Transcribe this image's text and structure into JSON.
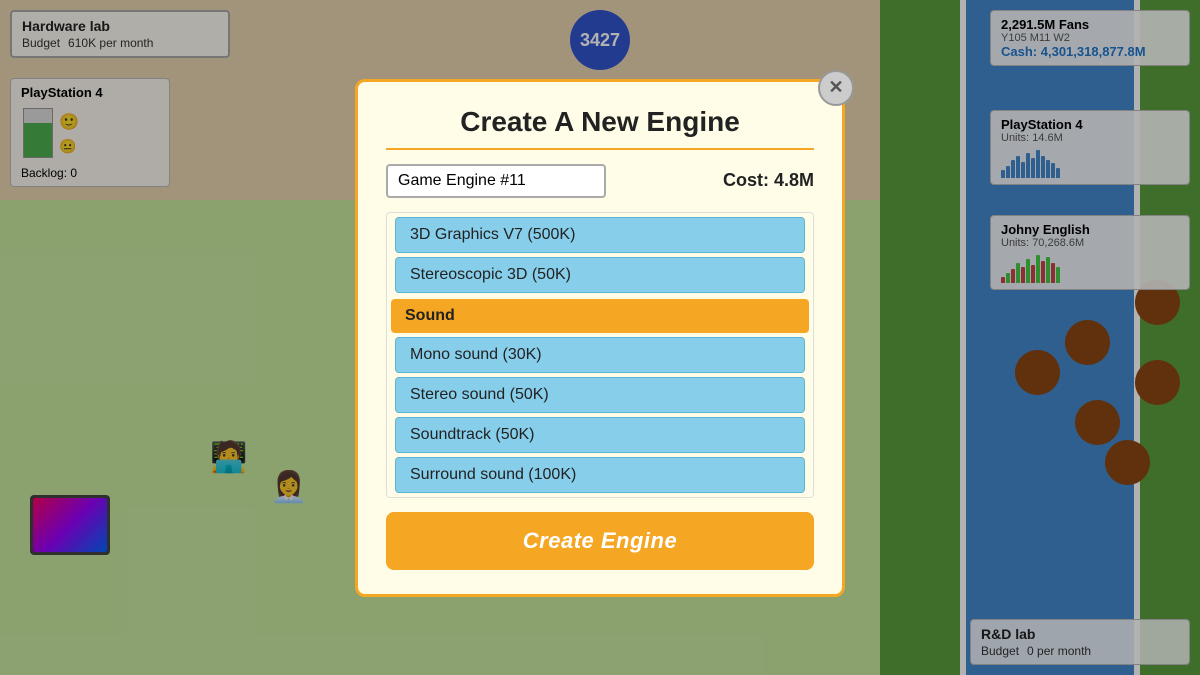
{
  "game": {
    "counter": "3427",
    "hud": {
      "fans": "2,291.5M Fans",
      "year": "Y105 M11 W2",
      "cash_label": "Cash:",
      "cash_value": "4,301,318,877.8M"
    },
    "hardware_lab": {
      "title": "Hardware lab",
      "budget_label": "Budget",
      "budget_value": "610K per month"
    },
    "playstation4_left": {
      "title": "PlayStation 4",
      "backlog_label": "Backlog:",
      "backlog_value": "0"
    },
    "playstation4_right": {
      "title": "PlayStation 4",
      "units_label": "Units:",
      "units_value": "14.6M"
    },
    "johny_english": {
      "title": "Johny English",
      "units_label": "Units:",
      "units_value": "70,268.6M"
    },
    "rd_lab": {
      "title": "R&D lab",
      "budget_label": "Budget",
      "budget_value": "0 per month"
    }
  },
  "modal": {
    "title": "Create A New Engine",
    "close_button": "✕",
    "engine_name": "Game Engine #11",
    "cost_label": "Cost: 4.8M",
    "features": [
      {
        "type": "item",
        "text": "3D Graphics V7 (500K)"
      },
      {
        "type": "item",
        "text": "Stereoscopic 3D (50K)"
      },
      {
        "type": "category",
        "text": "Sound"
      },
      {
        "type": "item",
        "text": "Mono sound (30K)"
      },
      {
        "type": "item",
        "text": "Stereo sound (50K)"
      },
      {
        "type": "item",
        "text": "Soundtrack (50K)"
      },
      {
        "type": "item",
        "text": "Surround sound (100K)"
      }
    ],
    "create_button": "Create Engine"
  }
}
